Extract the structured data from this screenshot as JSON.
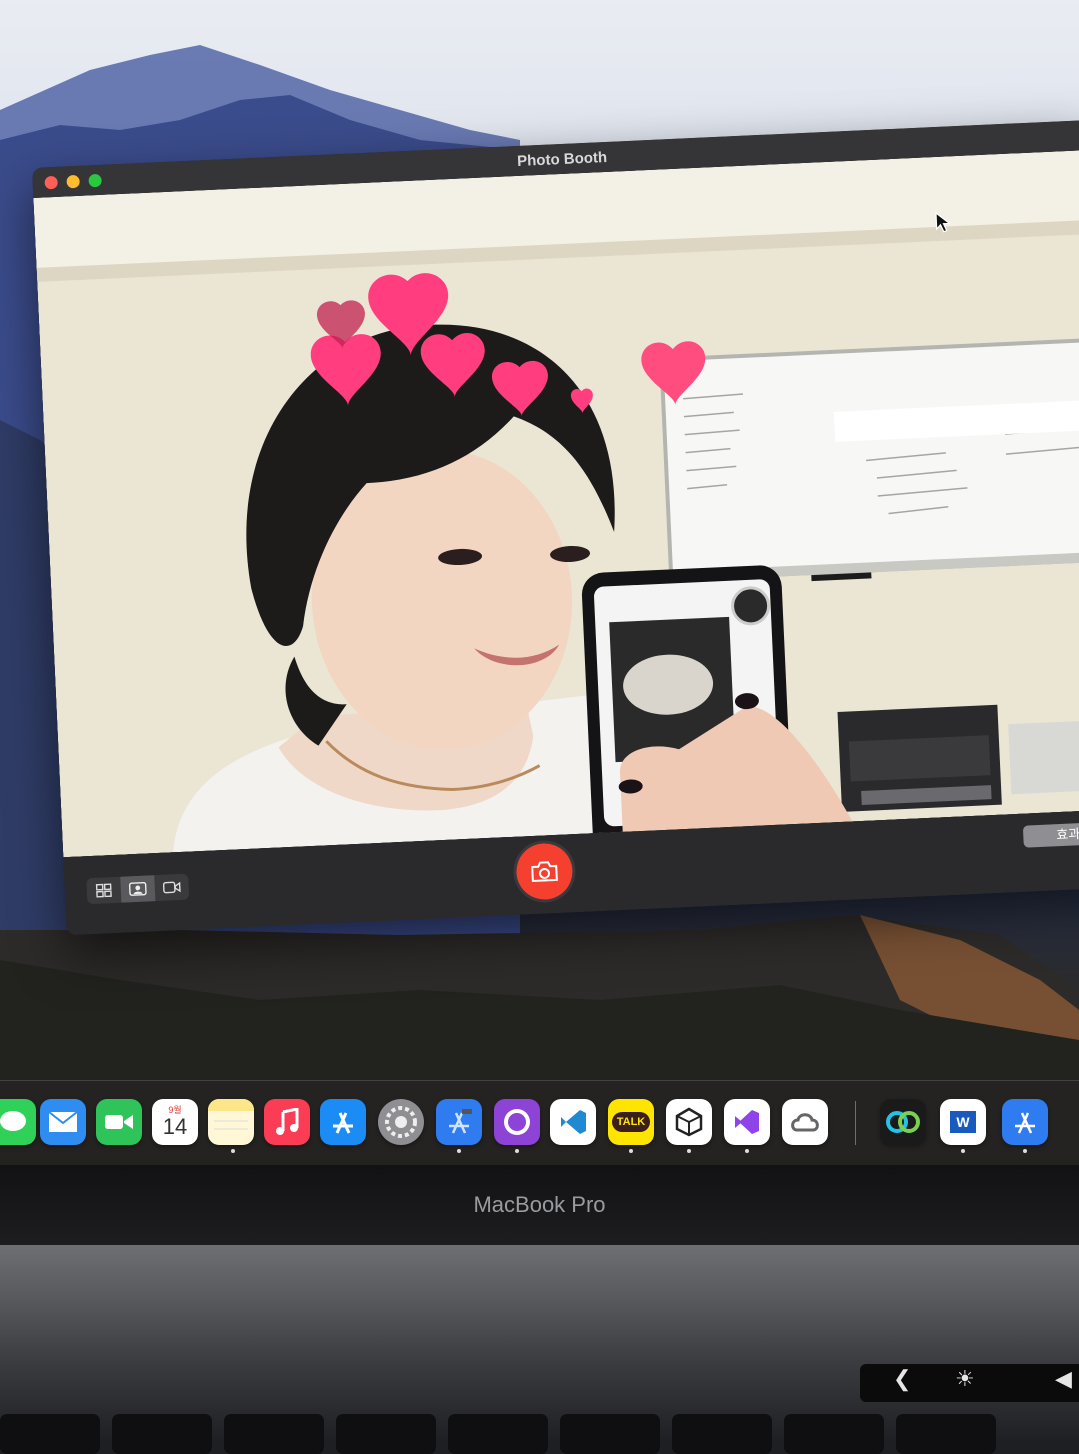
{
  "window": {
    "title": "Photo Booth"
  },
  "controls": {
    "modes": [
      {
        "name": "grid-mode",
        "icon": "four-up-grid-icon"
      },
      {
        "name": "single-photo-mode",
        "icon": "portrait-icon"
      },
      {
        "name": "video-mode",
        "icon": "video-camera-icon"
      }
    ],
    "shutter_icon": "camera-icon",
    "effects_label": "효과"
  },
  "dock": {
    "apps": [
      {
        "name": "messages",
        "color": "#2fd158"
      },
      {
        "name": "mail",
        "color": "#2f8cf0"
      },
      {
        "name": "facetime",
        "color": "#2fc45a"
      },
      {
        "name": "calendar",
        "month": "9월",
        "day": "14",
        "color": "#ffffff"
      },
      {
        "name": "notes",
        "color": "#fde68a"
      },
      {
        "name": "music",
        "color": "#fa3d55"
      },
      {
        "name": "app-store",
        "color": "#1b8cf5"
      },
      {
        "name": "system-preferences",
        "color": "#8e8e93"
      },
      {
        "name": "xcode",
        "color": "#2f7bf0"
      },
      {
        "name": "github-desktop",
        "color": "#8c43d6"
      },
      {
        "name": "visual-studio-code",
        "color": "#ffffff"
      },
      {
        "name": "kakaotalk",
        "label": "TALK",
        "color": "#fee500"
      },
      {
        "name": "unity-hub",
        "color": "#ffffff"
      },
      {
        "name": "visual-studio",
        "color": "#ffffff"
      },
      {
        "name": "creative-cloud",
        "color": "#ffffff"
      },
      {
        "name": "webex",
        "color": "#1a1a1a"
      },
      {
        "name": "microsoft-word",
        "label": "W",
        "color": "#ffffff"
      },
      {
        "name": "simulator",
        "color": "#2f7bf0"
      }
    ]
  },
  "laptop": {
    "brand": "MacBook Pro"
  },
  "colors": {
    "shutter": "#f5402f",
    "heart": "#ff3d7f",
    "close": "#ff5f57",
    "minimize": "#febc2e",
    "zoom": "#28c840"
  }
}
